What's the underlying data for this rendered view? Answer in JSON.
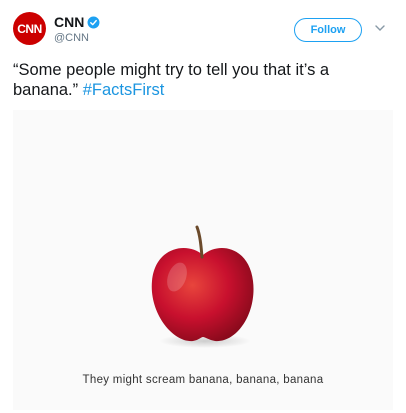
{
  "tweet": {
    "author": {
      "avatar_text": "CNN",
      "display_name": "CNN",
      "handle": "@CNN",
      "verified_icon": "verified-badge-icon"
    },
    "follow_label": "Follow",
    "menu_icon": "chevron-down-icon",
    "text_main": "“Some people might try to tell you that it’s a banana.” ",
    "hashtag": "#FactsFirst"
  },
  "media": {
    "image_icon": "red-apple-icon",
    "caption": "They might scream banana, banana, banana"
  },
  "colors": {
    "brand_red": "#cc0000",
    "link_blue": "#1b95e0",
    "follow_blue": "#1da1f2",
    "apple_red": "#c8102e"
  }
}
